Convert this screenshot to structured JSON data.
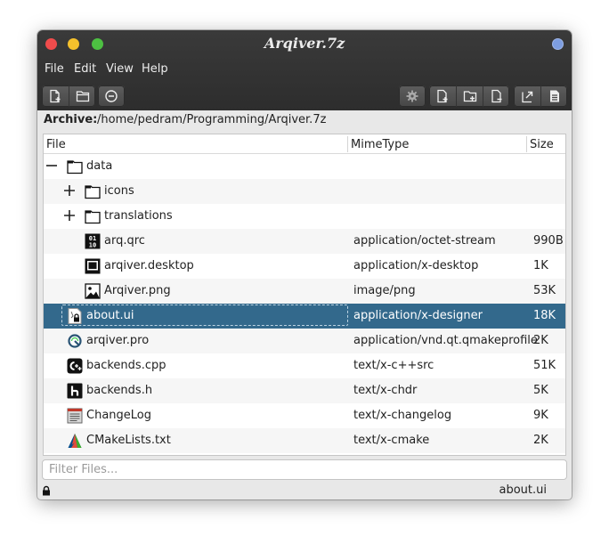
{
  "window": {
    "title": "Arqiver.7z"
  },
  "menu": [
    "File",
    "Edit",
    "View",
    "Help"
  ],
  "toolbar": {
    "left": [
      "new-archive-icon",
      "open-archive-icon",
      "close-archive-icon"
    ],
    "right_single": "settings-icon",
    "right_group1": [
      "add-file-icon",
      "add-folder-icon",
      "remove-icon"
    ],
    "right_group2": [
      "extract-icon",
      "view-icon"
    ]
  },
  "archive": {
    "label": "Archive:",
    "path": "/home/pedram/Programming/Arqiver.7z"
  },
  "columns": {
    "file": "File",
    "mimetype": "MimeType",
    "size": "Size"
  },
  "rows": [
    {
      "name": "data",
      "mime": "",
      "size": "",
      "icon": "folder-icon",
      "depth": 0,
      "expander": "collapse",
      "selected": false
    },
    {
      "name": "icons",
      "mime": "",
      "size": "",
      "icon": "folder-icon",
      "depth": 1,
      "expander": "expand",
      "selected": false
    },
    {
      "name": "translations",
      "mime": "",
      "size": "",
      "icon": "folder-icon",
      "depth": 1,
      "expander": "expand",
      "selected": false
    },
    {
      "name": "arq.qrc",
      "mime": "application/octet-stream",
      "size": "990B",
      "icon": "binary-file-icon",
      "depth": 1,
      "expander": "",
      "selected": false
    },
    {
      "name": "arqiver.desktop",
      "mime": "application/x-desktop",
      "size": "1K",
      "icon": "desktop-file-icon",
      "depth": 1,
      "expander": "",
      "selected": false
    },
    {
      "name": "Arqiver.png",
      "mime": "image/png",
      "size": "53K",
      "icon": "image-file-icon",
      "depth": 1,
      "expander": "",
      "selected": false
    },
    {
      "name": "about.ui",
      "mime": "application/x-designer",
      "size": "18K",
      "icon": "designer-file-icon",
      "depth": 0,
      "expander": "",
      "selected": true
    },
    {
      "name": "arqiver.pro",
      "mime": "application/vnd.qt.qmakeprofile",
      "size": "2K",
      "icon": "qmake-file-icon",
      "depth": 0,
      "expander": "",
      "selected": false
    },
    {
      "name": "backends.cpp",
      "mime": "text/x-c++src",
      "size": "51K",
      "icon": "cpp-file-icon",
      "depth": 0,
      "expander": "",
      "selected": false
    },
    {
      "name": "backends.h",
      "mime": "text/x-chdr",
      "size": "5K",
      "icon": "header-file-icon",
      "depth": 0,
      "expander": "",
      "selected": false
    },
    {
      "name": "ChangeLog",
      "mime": "text/x-changelog",
      "size": "9K",
      "icon": "changelog-file-icon",
      "depth": 0,
      "expander": "",
      "selected": false
    },
    {
      "name": "CMakeLists.txt",
      "mime": "text/x-cmake",
      "size": "2K",
      "icon": "cmake-file-icon",
      "depth": 0,
      "expander": "",
      "selected": false
    }
  ],
  "filter": {
    "placeholder": "Filter Files...",
    "value": ""
  },
  "status": {
    "text": "about.ui",
    "icon": "lock-icon"
  },
  "colors": {
    "selection": "#33698c",
    "titlebar": "#333333"
  }
}
